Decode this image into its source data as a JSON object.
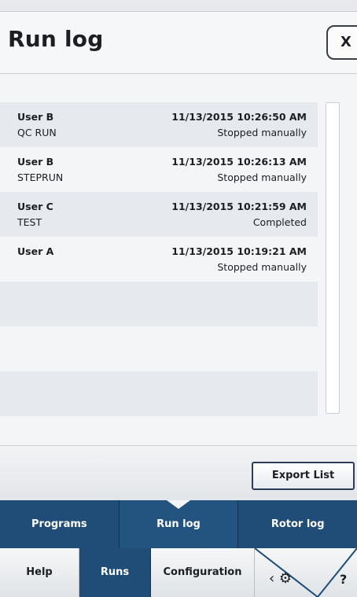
{
  "header": {
    "title": "Run log",
    "close_label": "X"
  },
  "runs": [
    {
      "user": "User B",
      "program": "QC RUN",
      "timestamp": "11/13/2015 10:26:50 AM",
      "status": "Stopped manually"
    },
    {
      "user": "User B",
      "program": "STEPRUN",
      "timestamp": "11/13/2015 10:26:13 AM",
      "status": "Stopped manually"
    },
    {
      "user": "User C",
      "program": "TEST",
      "timestamp": "11/13/2015 10:21:59 AM",
      "status": "Completed"
    },
    {
      "user": "User A",
      "program": "",
      "timestamp": "11/13/2015 10:19:21 AM",
      "status": "Stopped manually"
    }
  ],
  "footer": {
    "export_label": "Export List"
  },
  "tabs": {
    "programs": "Programs",
    "runlog": "Run log",
    "rotorlog": "Rotor log"
  },
  "bottom_nav": {
    "help": "Help",
    "runs": "Runs",
    "configuration": "Configuration",
    "tools_icon_text": "‹ ⚙",
    "help_icon_text": "?"
  },
  "colors": {
    "nav_blue": "#1f4d78",
    "row_alt": "#e6e9ee"
  }
}
